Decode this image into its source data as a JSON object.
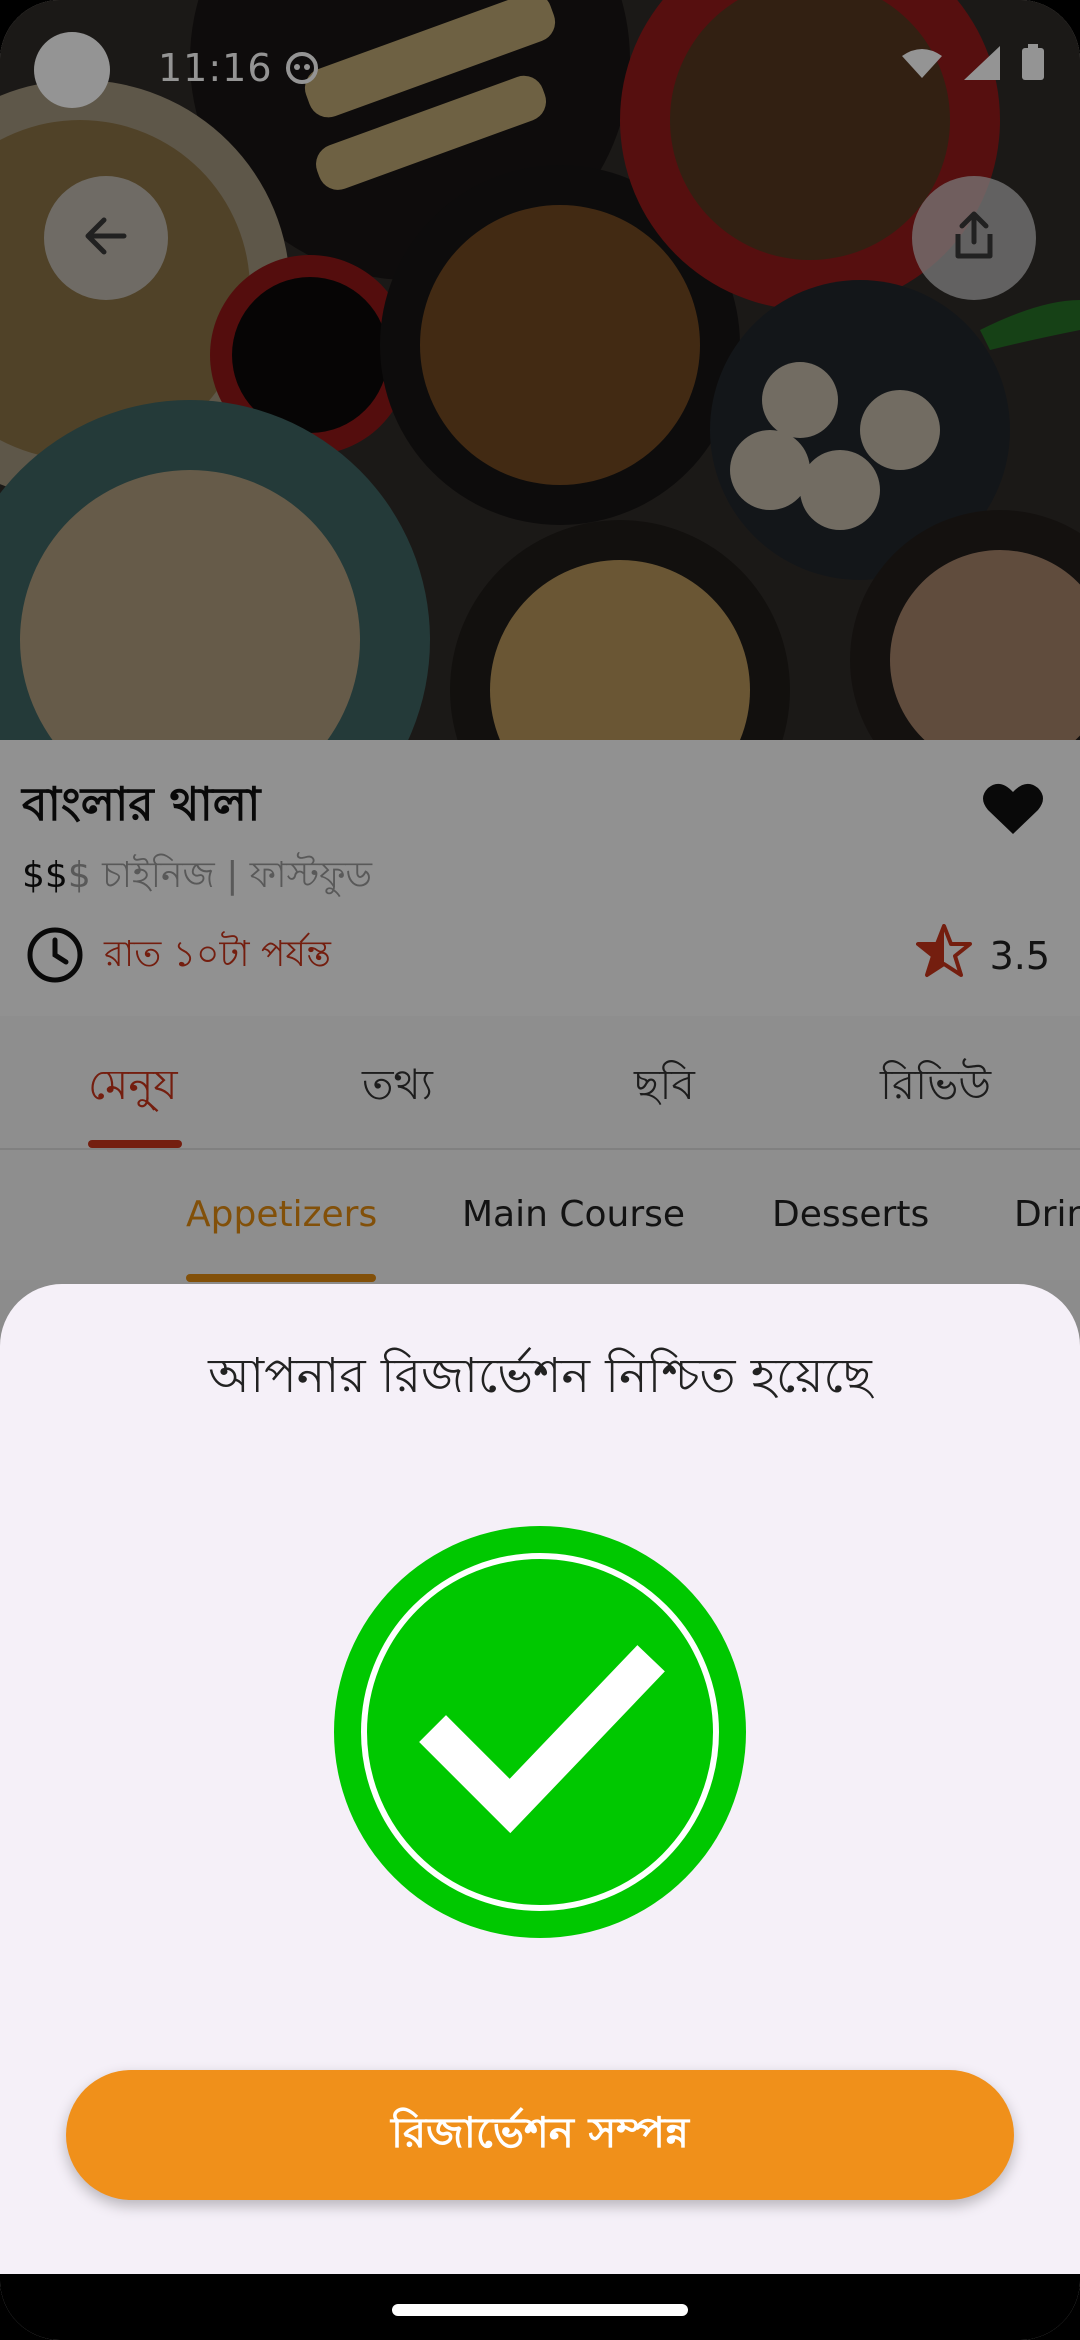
{
  "status_bar": {
    "time": "11:16"
  },
  "restaurant": {
    "name": "বাংলার থালা",
    "price_level_active": "$$",
    "price_level_inactive": "$",
    "cuisine": " চাইনিজ | ফাস্টফুড",
    "hours": "রাত ১০টা পর্যন্ত",
    "rating": "3.5"
  },
  "tabs": [
    "মেনু্য",
    "তথ্য",
    "ছবি",
    "রিভিউ"
  ],
  "active_tab_index": 0,
  "menu_categories": [
    "Appetizers",
    "Main Course",
    "Desserts",
    "Drin"
  ],
  "active_category_index": 0,
  "dialog": {
    "title": "আপনার রিজার্ভেশন নিশ্চিত হয়েছে",
    "button_label": "রিজার্ভেশন সম্পন্ন"
  },
  "icons": {
    "back": "arrow-left-icon",
    "share": "share-icon",
    "favorite": "heart-icon",
    "clock": "clock-icon",
    "rating": "star-half-icon",
    "success": "check-circle-icon"
  },
  "colors": {
    "accent_red": "#c8341a",
    "accent_orange": "#f0901a",
    "success_green": "#00c800",
    "sheet_background": "#f5f0f8"
  }
}
